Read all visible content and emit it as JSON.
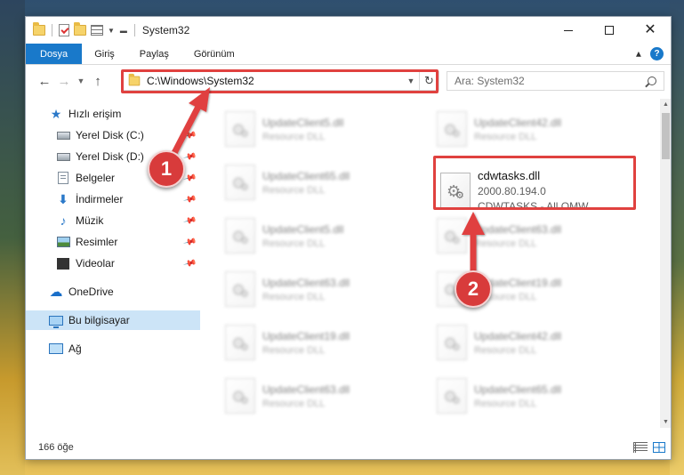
{
  "window": {
    "title": "System32"
  },
  "ribbon": {
    "tabs": [
      "Dosya",
      "Giriş",
      "Paylaş",
      "Görünüm"
    ],
    "help": "?"
  },
  "address": {
    "path": "C:\\Windows\\System32"
  },
  "search": {
    "placeholder": "Ara: System32"
  },
  "nav": {
    "items": [
      {
        "label": "Hızlı erişim",
        "icon": "star-icon"
      },
      {
        "label": "Yerel Disk (C:)",
        "icon": "disk-icon"
      },
      {
        "label": "Yerel Disk (D:)",
        "icon": "disk-icon"
      },
      {
        "label": "Belgeler",
        "icon": "documents-icon"
      },
      {
        "label": "İndirmeler",
        "icon": "download-icon"
      },
      {
        "label": "Müzik",
        "icon": "music-icon"
      },
      {
        "label": "Resimler",
        "icon": "pictures-icon"
      },
      {
        "label": "Videolar",
        "icon": "videos-icon"
      },
      {
        "label": "OneDrive",
        "icon": "cloud-icon"
      },
      {
        "label": "Bu bilgisayar",
        "icon": "computer-icon"
      },
      {
        "label": "Ağ",
        "icon": "network-icon"
      }
    ],
    "selected": "Bu bilgisayar"
  },
  "files": {
    "left": [
      {
        "name": "UpdateClient5.dll",
        "sub": "Resource DLL"
      },
      {
        "name": "UpdateClient65.dll",
        "sub": "Resource DLL"
      },
      {
        "name": "UpdateClient5.dll",
        "sub": "Resource DLL"
      },
      {
        "name": "UpdateClient63.dll",
        "sub": "Resource DLL"
      },
      {
        "name": "UpdateClient19.dll",
        "sub": "Resource DLL"
      },
      {
        "name": "UpdateClient63.dll",
        "sub": "Resource DLL"
      }
    ],
    "right": [
      {
        "name": "UpdateClient42.dll",
        "sub": "Resource DLL"
      },
      {
        "name": "cdwtasks.dll",
        "sub": "2000.80.194.0",
        "sub2": "CDWTASKS - All OMW ..."
      },
      {
        "name": "UpdateClient63.dll",
        "sub": "Resource DLL"
      },
      {
        "name": "UpdateClient19.dll",
        "sub": "Resource DLL"
      },
      {
        "name": "UpdateClient42.dll",
        "sub": "Resource DLL"
      },
      {
        "name": "UpdateClient65.dll",
        "sub": "Resource DLL"
      }
    ]
  },
  "status": {
    "count": "166 öğe"
  },
  "callouts": [
    "1",
    "2"
  ],
  "colors": {
    "accent": "#1979ca",
    "highlight": "#e0413f",
    "selected": "#cce4f7"
  }
}
